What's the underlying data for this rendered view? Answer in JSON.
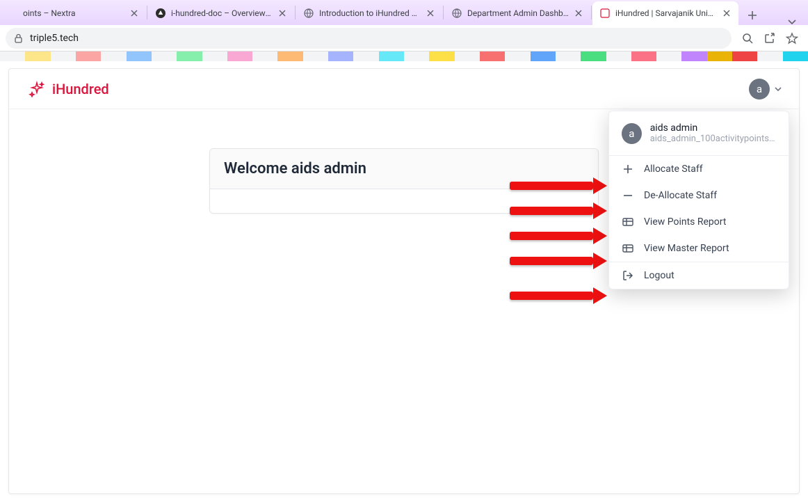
{
  "browser": {
    "tabs": [
      {
        "title": "oints – Nextra"
      },
      {
        "title": "i-hundred-doc – Overview - N"
      },
      {
        "title": "Introduction to iHundred – N"
      },
      {
        "title": "Department Admin Dashboa"
      },
      {
        "title": "iHundred | Sarvajanik Univers"
      }
    ],
    "url": "triple5.tech"
  },
  "app": {
    "brand": "iHundred",
    "avatar_letter": "a",
    "welcome_heading": "Welcome aids admin"
  },
  "dropdown": {
    "user_name": "aids admin",
    "user_email": "aids_admin_100activitypoints@s",
    "avatar_letter": "a",
    "items": [
      {
        "label": "Allocate Staff",
        "icon": "plus"
      },
      {
        "label": "De-Allocate Staff",
        "icon": "minus"
      },
      {
        "label": "View Points Report",
        "icon": "table"
      },
      {
        "label": "View Master Report",
        "icon": "table"
      }
    ],
    "logout_label": "Logout"
  }
}
